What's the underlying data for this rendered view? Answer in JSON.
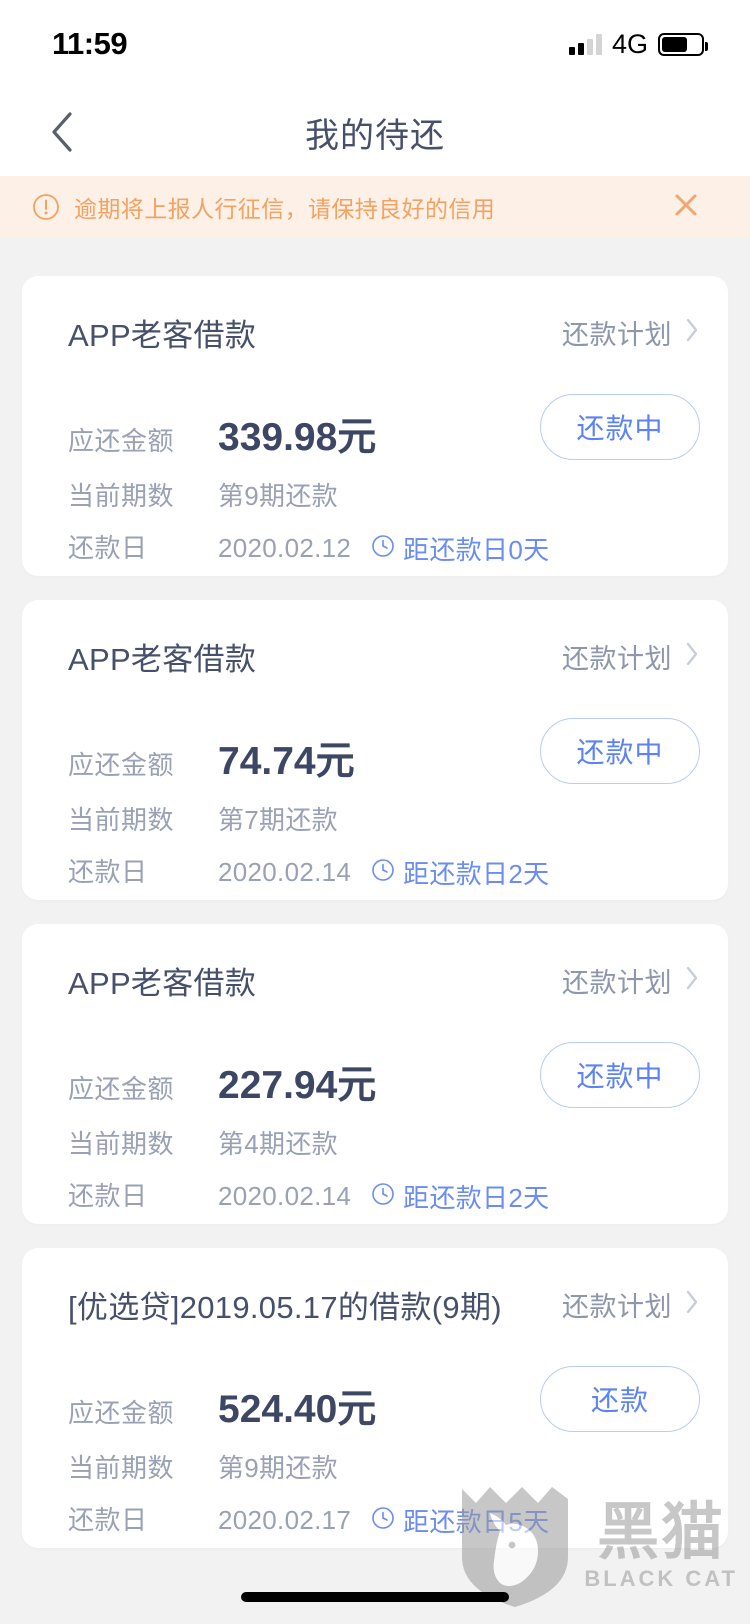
{
  "status_bar": {
    "time": "11:59",
    "network": "4G",
    "signal_bars_filled": 2,
    "signal_bars_total": 4,
    "battery_percent": 66
  },
  "nav": {
    "back_icon": "chevron-left-icon",
    "title": "我的待还"
  },
  "banner": {
    "icon": "exclamation-circle-icon",
    "text": "逾期将上报人行征信，请保持良好的信用",
    "close_icon": "close-icon",
    "bg_color": "#fdf0e7",
    "text_color": "#f3a261"
  },
  "labels": {
    "amount": "应还金额",
    "period": "当前期数",
    "due_date": "还款日",
    "plan": "还款计划"
  },
  "colors": {
    "page_bg": "#f2f2f2",
    "card_bg": "#ffffff",
    "title": "#47506b",
    "label": "#9aa1b5",
    "amount": "#3d4663",
    "accent_blue": "#5c82f5",
    "countdown": "#6b8cf5",
    "warning": "#f3a261"
  },
  "cards": [
    {
      "title": "APP老客借款",
      "plan_label": "还款计划",
      "amount": "339.98元",
      "period": "第9期还款",
      "due_date": "2020.02.12",
      "countdown": "距还款日0天",
      "button": "还款中"
    },
    {
      "title": "APP老客借款",
      "plan_label": "还款计划",
      "amount": "74.74元",
      "period": "第7期还款",
      "due_date": "2020.02.14",
      "countdown": "距还款日2天",
      "button": "还款中"
    },
    {
      "title": "APP老客借款",
      "plan_label": "还款计划",
      "amount": "227.94元",
      "period": "第4期还款",
      "due_date": "2020.02.14",
      "countdown": "距还款日2天",
      "button": "还款中"
    },
    {
      "title": "[优选贷]2019.05.17的借款(9期)",
      "plan_label": "还款计划",
      "amount": "524.40元",
      "period": "第9期还款",
      "due_date": "2020.02.17",
      "countdown": "距还款日5天",
      "button": "还款"
    }
  ],
  "watermark": {
    "cn": "黑猫",
    "en": "BLACK CAT",
    "icon": "cat-shield-icon"
  }
}
